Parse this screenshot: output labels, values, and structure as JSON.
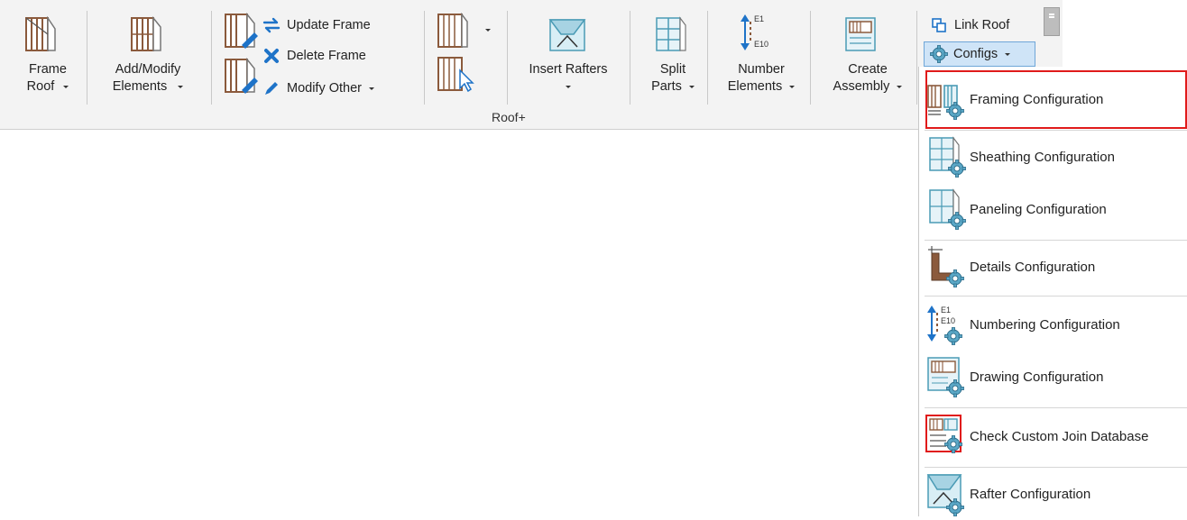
{
  "ribbon": {
    "group_label": "Roof+",
    "frame_roof": {
      "line1": "Frame",
      "line2": "Roof"
    },
    "add_modify": {
      "line1": "Add/Modify",
      "line2": "Elements"
    },
    "update_frame": "Update Frame",
    "delete_frame": "Delete Frame",
    "modify_other": "Modify Other",
    "insert_rafters": "Insert Rafters",
    "split_parts": {
      "line1": "Split",
      "line2": "Parts"
    },
    "number_elements": {
      "line1": "Number",
      "line2": "Elements",
      "icon_top": "E1",
      "icon_bottom": "E10"
    },
    "create_assembly": {
      "line1": "Create",
      "line2": "Assembly"
    },
    "link_roof": "Link Roof",
    "configs": "Configs"
  },
  "configs_menu": {
    "items": [
      {
        "label": "Framing Configuration",
        "icon": "framing-config-icon"
      },
      {
        "label": "Sheathing Configuration",
        "icon": "sheathing-config-icon"
      },
      {
        "label": "Paneling Configuration",
        "icon": "paneling-config-icon"
      },
      {
        "label": "Details Configuration",
        "icon": "details-config-icon"
      },
      {
        "label": "Numbering Configuration",
        "icon": "numbering-config-icon",
        "icon_top": "E1",
        "icon_bottom": "E10"
      },
      {
        "label": "Drawing Configuration",
        "icon": "drawing-config-icon"
      },
      {
        "label": "Check Custom Join Database",
        "icon": "join-database-icon"
      },
      {
        "label": "Rafter Configuration",
        "icon": "rafter-config-icon"
      }
    ]
  },
  "colors": {
    "ribbon_bg": "#f3f3f3",
    "highlight": "#e01b1b",
    "configs_bg": "#cfe4f7",
    "accent_blue": "#1e73c8",
    "wood": "#8b5a3c",
    "teal": "#4a9bb5"
  }
}
